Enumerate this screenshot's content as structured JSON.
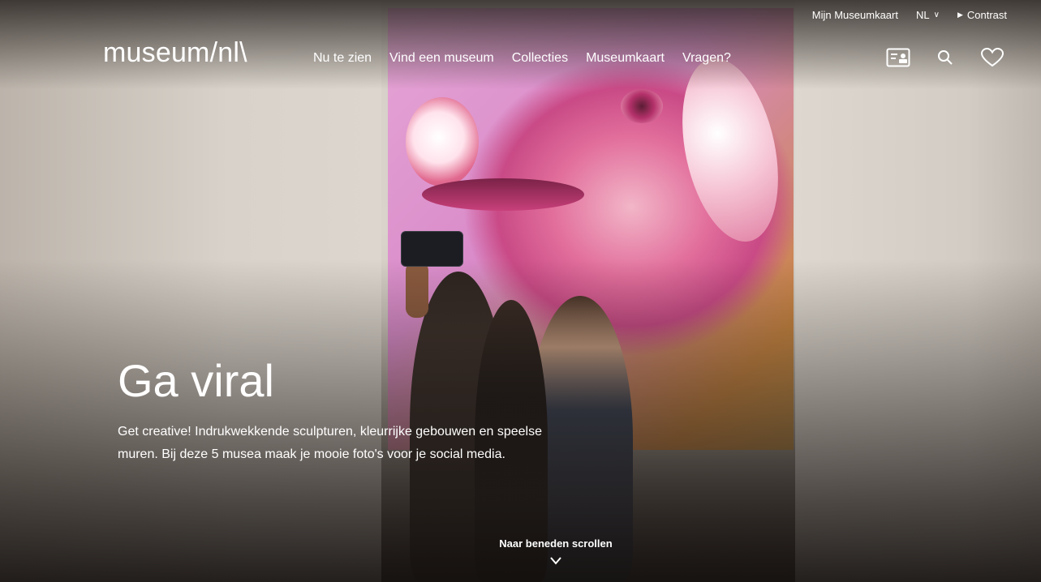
{
  "utility_bar": {
    "account_link": "Mijn Museumkaart",
    "language": "NL",
    "contrast": "Contrast"
  },
  "header": {
    "logo": "museum/nl\\",
    "nav": [
      {
        "label": "Nu te zien"
      },
      {
        "label": "Vind een museum"
      },
      {
        "label": "Collecties"
      },
      {
        "label": "Museumkaart"
      },
      {
        "label": "Vragen?"
      }
    ],
    "icons": [
      "museumkaart-card-icon",
      "search-icon",
      "heart-icon"
    ]
  },
  "hero": {
    "title": "Ga viral",
    "intro": "Get creative! Indrukwekkende sculpturen, kleurrijke gebouwen en speelse muren. Bij deze 5 musea maak je mooie foto's voor je social media.",
    "scroll_label": "Naar beneden scrollen"
  },
  "colors": {
    "text": "#ffffff",
    "accent_pink": "#d98bc9"
  }
}
